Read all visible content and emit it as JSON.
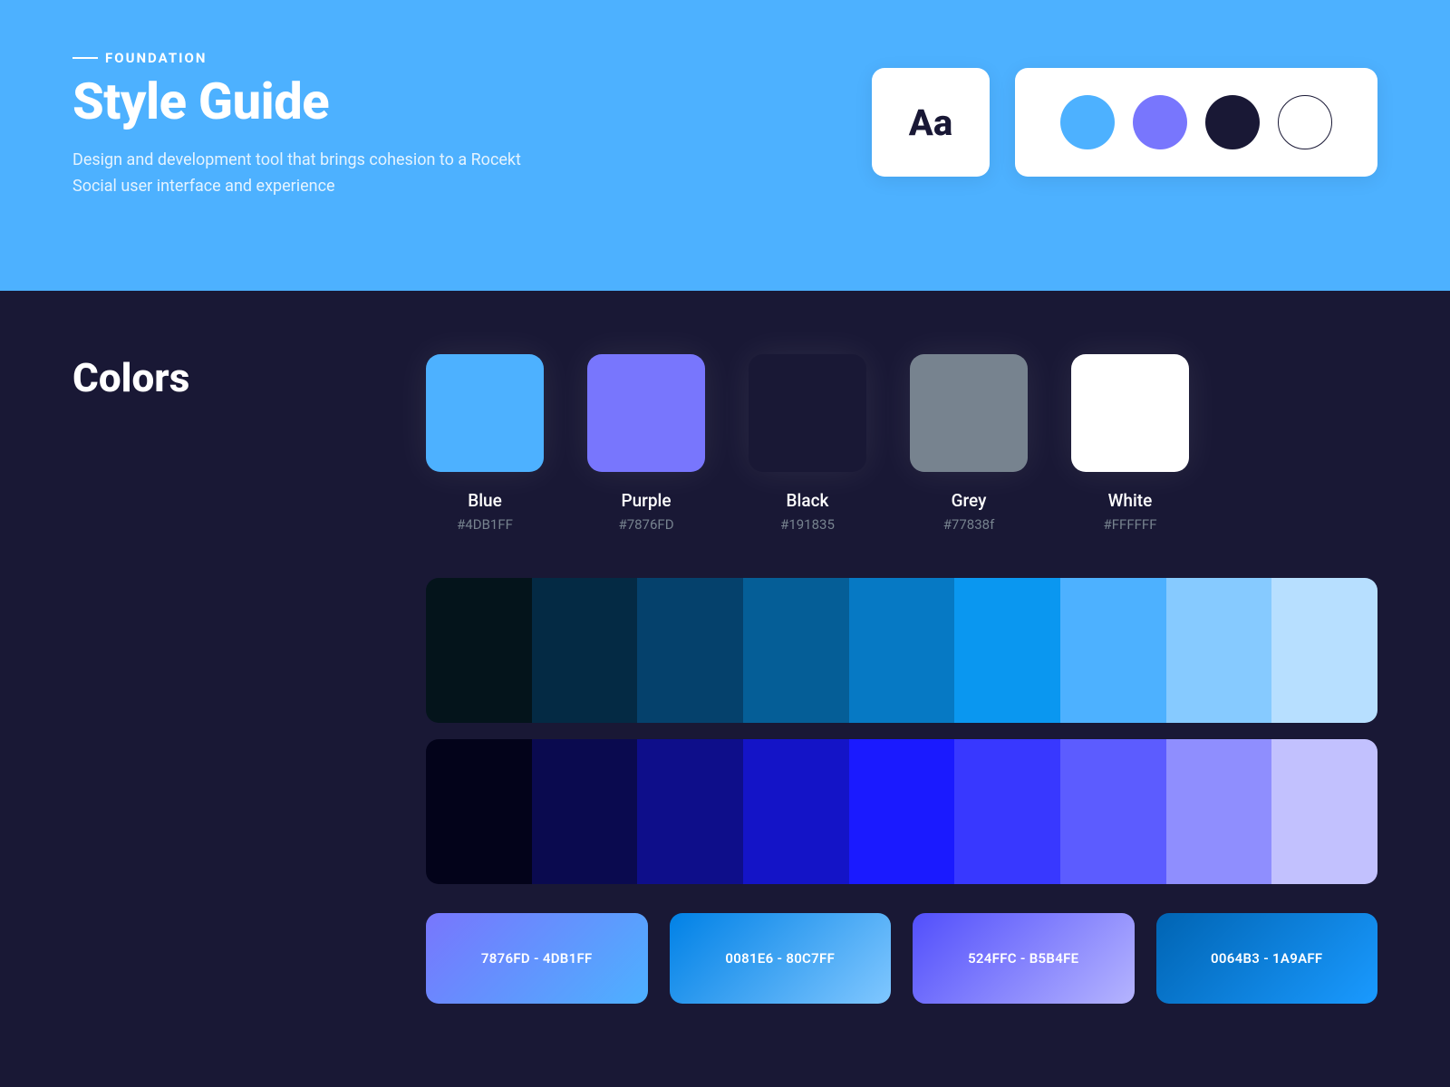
{
  "header": {
    "overline": "FOUNDATION",
    "title": "Style Guide",
    "subtitle": "Design and development tool that brings cohesion to a Rocekt Social user interface and experience",
    "typography_sample": "Aa",
    "palette_dots": [
      {
        "color": "#4DB1FF"
      },
      {
        "color": "#7876FD"
      },
      {
        "color": "#191835"
      },
      {
        "color": "#FFFFFF",
        "outline": true
      }
    ]
  },
  "colors": {
    "title": "Colors",
    "swatches": [
      {
        "name": "Blue",
        "hex": "#4DB1FF"
      },
      {
        "name": "Purple",
        "hex": "#7876FD"
      },
      {
        "name": "Black",
        "hex": "#191835"
      },
      {
        "name": "Grey",
        "hex": "#77838f"
      },
      {
        "name": "White",
        "hex": "#FFFFFF"
      }
    ],
    "ramps": [
      [
        "#04141B",
        "#042A44",
        "#05416C",
        "#055E97",
        "#0679C4",
        "#0A97F0",
        "#4DB1FF",
        "#86CAFF",
        "#B7DFFF"
      ],
      [
        "#03031A",
        "#0A0A4F",
        "#0E0E8A",
        "#1414C7",
        "#1A1AFF",
        "#3838FF",
        "#5C5CFF",
        "#8F8EFE",
        "#C2C1FE"
      ]
    ],
    "gradients": [
      {
        "label": "7876FD - 4DB1FF",
        "from": "#7876FD",
        "to": "#4DB1FF"
      },
      {
        "label": "0081E6 - 80C7FF",
        "from": "#0081E6",
        "to": "#80C7FF"
      },
      {
        "label": "524FFC - B5B4FE",
        "from": "#524FFC",
        "to": "#B5B4FE"
      },
      {
        "label": "0064B3 - 1A9AFF",
        "from": "#0064B3",
        "to": "#1A9AFF"
      }
    ]
  }
}
